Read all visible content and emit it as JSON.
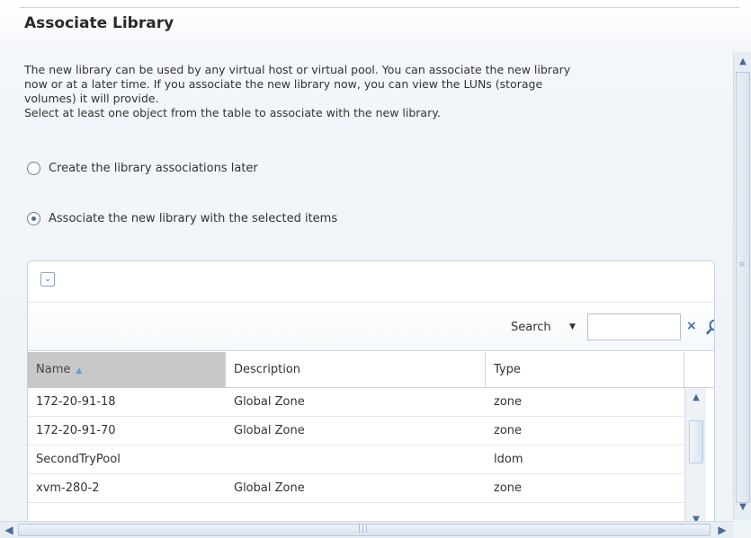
{
  "title": "Associate Library",
  "description": {
    "line1": "The new library can be used by any virtual host or virtual pool. You can associate the new library",
    "line2": "now or at a later time. If you associate the new library now, you can view the LUNs (storage",
    "line3": "volumes) it will provide.",
    "line4": "Select at least one object from the table to associate with the new library."
  },
  "options": [
    {
      "label": "Create the library associations later",
      "selected": false
    },
    {
      "label": "Associate the new library with the selected items",
      "selected": true
    }
  ],
  "table": {
    "search_label": "Search",
    "search_value": "",
    "columns": [
      "Name",
      "Description",
      "Type"
    ],
    "sorted_column": "Name",
    "rows": [
      {
        "name": "172-20-91-18",
        "description": "Global Zone",
        "type": "zone"
      },
      {
        "name": "172-20-91-70",
        "description": "Global Zone",
        "type": "zone"
      },
      {
        "name": "SecondTryPool",
        "description": "",
        "type": "ldom"
      },
      {
        "name": "xvm-280-2",
        "description": "Global Zone",
        "type": "zone"
      }
    ]
  },
  "colors": {
    "accent": "#3e6ea8",
    "sorted_header": "#c8c8c8",
    "border": "#c6d1dd"
  }
}
